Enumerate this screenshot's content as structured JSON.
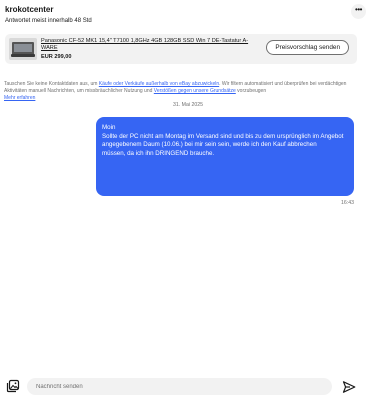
{
  "header": {
    "seller_name": "krokotcenter",
    "response_time": "Antwortet meist innerhalb 48 Std",
    "more_icon": "more-horizontal-icon"
  },
  "item": {
    "title": "Panasonic CF-52 MK1 15,4\" T7100 1,8GHz 4GB 128GB SSD Win 7 DE-Tastatur A-WARE",
    "price": "EUR 299,00",
    "offer_button": "Preisvorschlag senden"
  },
  "notice": {
    "part1": "Tauschen Sie keine Kontaktdaten aus, um ",
    "link1": "Käufe oder Verkäufe außerhalb von eBay abzuwickeln",
    "part2": ". Wir filtern automatisiert und überprüfen bei verdächtigen Aktivitäten manuell Nachrichten, um missbräuchlicher Nutzung und ",
    "link2": "Verstößen gegen unsere Grundsätze",
    "part3": " vorzubeugen ",
    "learn_more": "Mehr erfahren"
  },
  "conversation": {
    "date": "31. Mai 2025",
    "messages": [
      {
        "lines": [
          "Moin",
          "Sollte der PC nicht am Montag im Versand sind und bis zu dem ursprünglich im Angebot",
          "angegebenem Daum (10.06.) bei mir sein sein, werde ich den Kauf abbrechen",
          "müssen, da ich ihn DRINGEND brauche."
        ],
        "time": "16:43"
      }
    ]
  },
  "composer": {
    "placeholder": "Nachricht senden",
    "gallery_icon": "image-gallery-icon",
    "send_icon": "send-icon"
  },
  "colors": {
    "accent": "#3665f3",
    "surface": "#f2f2f2",
    "muted_text": "#707070"
  }
}
